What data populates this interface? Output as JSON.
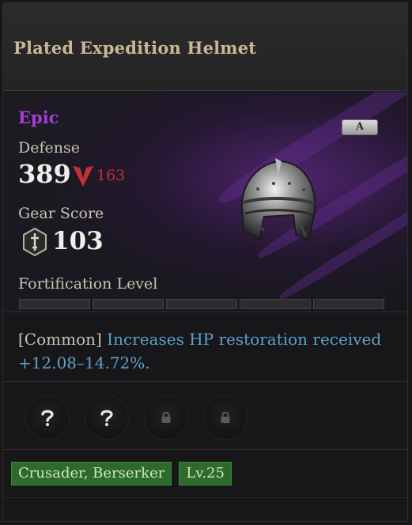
{
  "item": {
    "name": "Plated Expedition Helmet",
    "rarity": "Epic",
    "tier_badge": "A",
    "defense_label": "Defense",
    "defense_value": "389",
    "defense_diff": "163",
    "gear_score_label": "Gear Score",
    "gear_score_value": "103",
    "fortification_label": "Fortification Level",
    "fortification_segments_filled": 0,
    "fortification_segments_total": 5
  },
  "effect": {
    "tag": "[Common]",
    "text": "Increases HP restoration received +12.08–14.72%."
  },
  "sockets": [
    {
      "state": "unknown",
      "icon": "question-icon"
    },
    {
      "state": "unknown",
      "icon": "question-icon"
    },
    {
      "state": "locked",
      "icon": "lock-icon"
    },
    {
      "state": "locked",
      "icon": "lock-icon"
    }
  ],
  "tags": [
    "Crusader, Berserker",
    "Lv.25"
  ],
  "colors": {
    "rarity": "#a23ed8",
    "diff_down": "#c0313a",
    "effect": "#5fa0c9",
    "tag_bg": "#2e6a2c"
  }
}
